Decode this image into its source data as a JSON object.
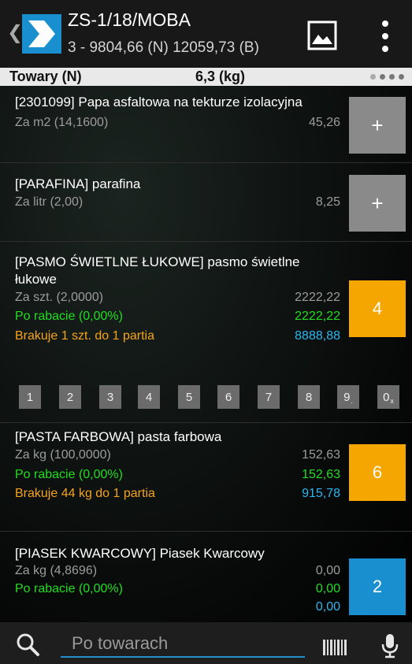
{
  "header": {
    "title": "ZS-1/18/MOBA",
    "subtitle": "3 - 9804,66 (N) 12059,73 (B)"
  },
  "summary": {
    "label": "Towary (N)",
    "weight": "6,3 (kg)"
  },
  "items": [
    {
      "name": "[2301099] Papa asfaltowa na tekturze izolacyjna",
      "price_label": "Za m2 (14,1600)",
      "price_value": "45,26",
      "qty": "+"
    },
    {
      "name": "[PARAFINA] parafina",
      "price_label": "Za litr (2,00)",
      "price_value": "8,25",
      "qty": "+"
    },
    {
      "name": "[PASMO ŚWIETLNE ŁUKOWE] pasmo świetlne łukowe",
      "price_label": "Za szt. (2,0000)",
      "price_value": "2222,22",
      "discount_label": "Po rabacie (0,00%)",
      "discount_value": "2222,22",
      "missing_label": "Brakuje 1 szt. do 1 partia",
      "total_value": "8888,88",
      "qty": "4"
    },
    {
      "name": "[PASTA FARBOWA] pasta farbowa",
      "price_label": "Za kg (100,0000)",
      "price_value": "152,63",
      "discount_label": "Po rabacie (0,00%)",
      "discount_value": "152,63",
      "missing_label": "Brakuje 44 kg do 1 partia",
      "total_value": "915,78",
      "qty": "6"
    },
    {
      "name": "[PIASEK KWARCOWY] Piasek Kwarcowy",
      "price_label": "Za kg (4,8696)",
      "price_value": "0,00",
      "discount_label": "Po rabacie (0,00%)",
      "discount_value": "0,00",
      "total_value": "0,00",
      "qty": "2"
    }
  ],
  "keypad": {
    "keys": [
      "1",
      "2",
      "3",
      "4",
      "5",
      "6",
      "7",
      "8",
      "9",
      "0"
    ],
    "key9_sub": ".",
    "key0_sub": "x"
  },
  "search": {
    "placeholder": "Po towarach"
  },
  "colors": {
    "accent_blue": "#1a8fd0",
    "accent_orange": "#f6a600",
    "discount_green": "#22dd22",
    "missing_orange": "#f5a41a",
    "total_blue": "#2bb6ee"
  },
  "icons": {
    "back": "chevron-left-icon",
    "logo": "app-logo",
    "image": "image-icon",
    "menu": "more-vertical-icon",
    "search": "search-icon",
    "barcode": "barcode-icon",
    "mic": "microphone-icon"
  }
}
